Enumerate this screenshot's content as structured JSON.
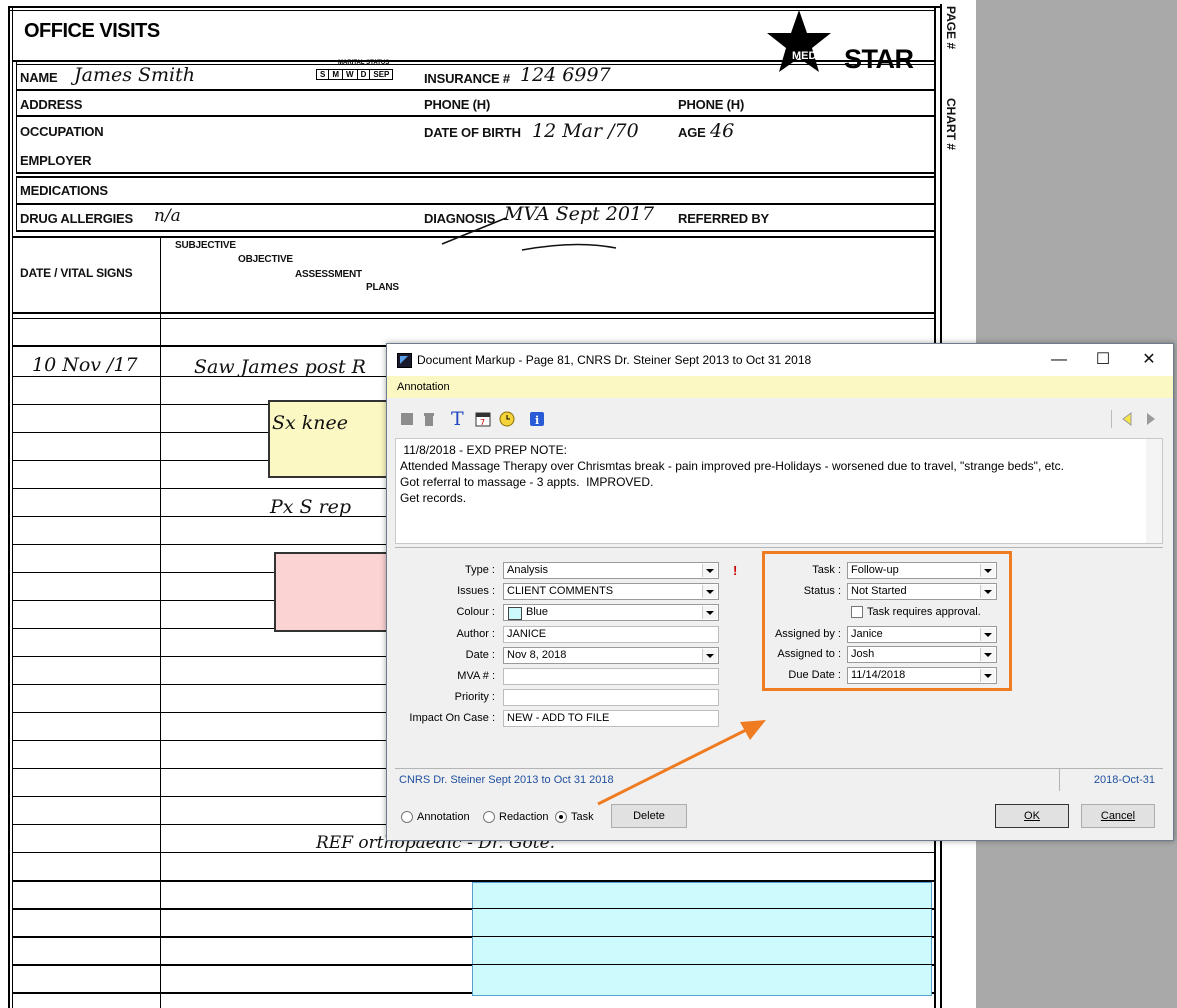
{
  "form": {
    "title": "OFFICE VISITS",
    "logo_text": "STAR",
    "logo_star_text": "MEDI",
    "page_label": "PAGE #",
    "chart_label": "CHART #",
    "marital_status_label": "MARITAL STATUS",
    "marital_options": [
      "S",
      "M",
      "W",
      "D",
      "SEP"
    ],
    "fields": {
      "name": "NAME",
      "insurance": "INSURANCE #",
      "address": "ADDRESS",
      "phone1": "PHONE (H)",
      "phone2": "PHONE (H)",
      "occupation": "OCCUPATION",
      "dob": "DATE OF BIRTH",
      "age": "AGE",
      "employer": "EMPLOYER",
      "medications": "MEDICATIONS",
      "allergies": "DRUG ALLERGIES",
      "diagnosis": "DIAGNOSIS",
      "referred": "REFERRED BY",
      "date_vitals": "DATE / VITAL SIGNS",
      "subjective": "SUBJECTIVE",
      "objective": "OBJECTIVE",
      "assessment": "ASSESSMENT",
      "plans": "PLANS"
    },
    "handwriting": {
      "name": "James Smith",
      "insurance": "124 6997",
      "dob": "12 Mar /70",
      "age": "46",
      "allergies": "n/a",
      "diagnosis": "MVA Sept 2017",
      "visit_date": "10 Nov /17",
      "visit_note": "Saw James post R",
      "note2": "Sx knee",
      "note3": "Px S rep",
      "ref_note": "REF orthopaedic - Dr. Gote."
    }
  },
  "dialog": {
    "title": "Document Markup - Page 81, CNRS Dr. Steiner Sept 2013 to Oct 31 2018",
    "window_controls": {
      "minimize": "—",
      "maximize": "☐",
      "close": "✕"
    },
    "tab": "Annotation",
    "notes_lines": [
      " 11/8/2018 - EXD PREP NOTE:",
      "",
      "Attended Massage Therapy over Chrismtas break - pain improved pre-Holidays - worsened due to travel, \"strange beds\", etc.",
      "Got referral to massage - 3 appts.  IMPROVED.",
      "",
      "Get records."
    ],
    "left_fields": [
      {
        "label": "Type :",
        "value": "Analysis",
        "kind": "combo"
      },
      {
        "label": "Issues :",
        "value": "CLIENT COMMENTS",
        "kind": "combo"
      },
      {
        "label": "Colour :",
        "value": "Blue",
        "kind": "combo"
      },
      {
        "label": "Author :",
        "value": "JANICE",
        "kind": "text"
      },
      {
        "label": "Date :",
        "value": "Nov 8, 2018",
        "kind": "combo"
      },
      {
        "label": "MVA # :",
        "value": "",
        "kind": "text"
      },
      {
        "label": "Priority :",
        "value": "",
        "kind": "text"
      },
      {
        "label": "Impact On Case :",
        "value": "NEW - ADD TO FILE",
        "kind": "text"
      }
    ],
    "right_fields": {
      "task_label": "Task :",
      "task_value": "Follow-up",
      "status_label": "Status :",
      "status_value": "Not Started",
      "approval_label": "Task requires approval.",
      "assigned_by_label": "Assigned by :",
      "assigned_by_value": "Janice",
      "assigned_to_label": "Assigned to :",
      "assigned_to_value": "Josh",
      "due_date_label": "Due Date :",
      "due_date_value": "11/14/2018"
    },
    "status_left": "CNRS Dr. Steiner Sept 2013 to Oct 31 2018",
    "status_right": "2018-Oct-31",
    "radios": {
      "annotation": "Annotation",
      "redaction": "Redaction",
      "task": "Task"
    },
    "buttons": {
      "delete": "Delete",
      "ok": "OK",
      "cancel": "Cancel"
    }
  },
  "colors": {
    "highlight_box": "#f07c22",
    "link_blue": "#1f4f9e",
    "tab_yellow": "#fcf8c4"
  }
}
